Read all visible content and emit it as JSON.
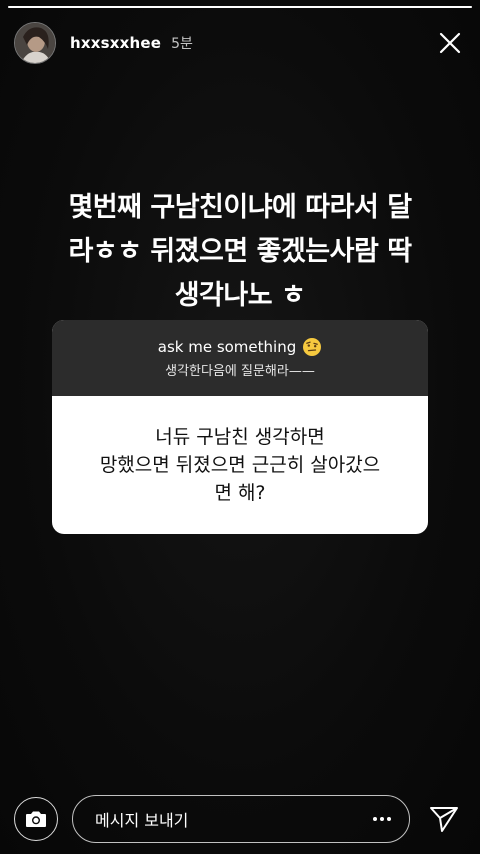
{
  "story": {
    "progress": 1.0
  },
  "header": {
    "username": "hxxsxxhee",
    "time": "5분",
    "avatar_icon": "profile-photo",
    "close_icon": "close-x"
  },
  "caption": {
    "text": "몇번째 구남친이냐에 따라서 달\n라ㅎㅎ 뒤졌으면 좋겠는사람 딱\n생각나노 ㅎ"
  },
  "question_sticker": {
    "title": "ask me something",
    "emoji": "raised-eyebrow-face",
    "subtitle": "생각한다음에 질문해라——",
    "answer": "너듀 구남친 생각하면\n망했으면 뒤졌으면 근근히 살아갔으\n면 해?"
  },
  "reply_bar": {
    "placeholder": "메시지 보내기",
    "camera_icon": "camera",
    "more_icon": "more-dots",
    "send_icon": "paper-plane"
  }
}
